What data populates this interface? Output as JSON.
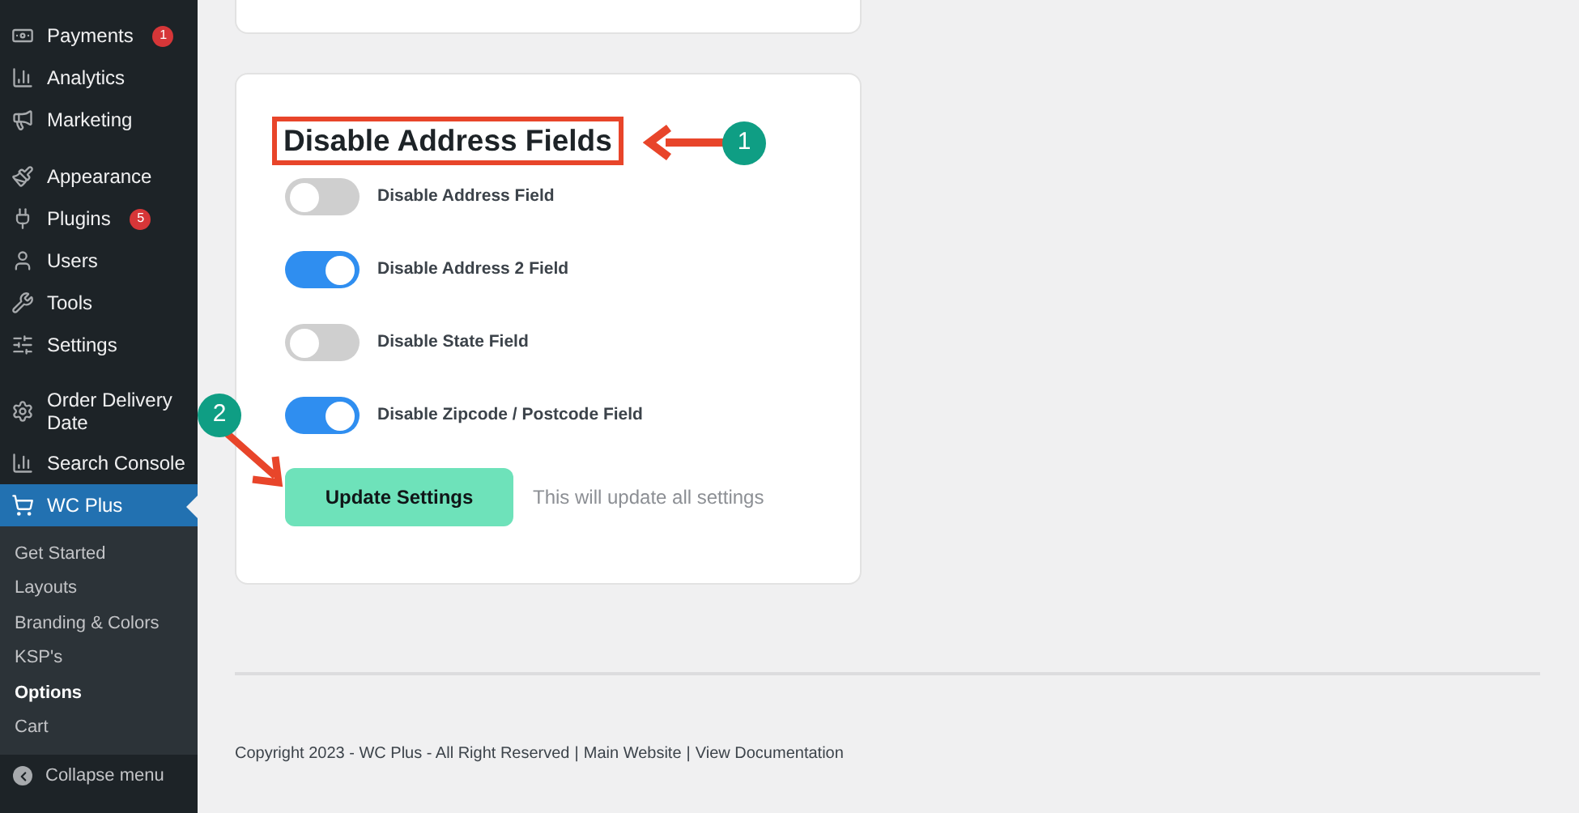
{
  "sidebar": {
    "groups": [
      [
        {
          "label": "Payments",
          "badge": "1",
          "selected": false
        },
        {
          "label": "Analytics",
          "selected": false
        },
        {
          "label": "Marketing",
          "selected": false
        }
      ],
      [
        {
          "label": "Appearance",
          "selected": false
        },
        {
          "label": "Plugins",
          "badge": "5",
          "selected": false
        },
        {
          "label": "Users",
          "selected": false
        },
        {
          "label": "Tools",
          "selected": false
        },
        {
          "label": "Settings",
          "selected": false
        }
      ],
      [
        {
          "label": "Order Delivery Date",
          "selected": false
        },
        {
          "label": "Search Console",
          "selected": false
        },
        {
          "label": "WC Plus",
          "selected": true
        }
      ]
    ],
    "submenu": [
      {
        "label": "Get Started",
        "selected": false
      },
      {
        "label": "Layouts",
        "selected": false
      },
      {
        "label": "Branding & Colors",
        "selected": false
      },
      {
        "label": "KSP's",
        "selected": false
      },
      {
        "label": "Options",
        "selected": true
      },
      {
        "label": "Cart",
        "selected": false
      }
    ],
    "collapse": "Collapse menu"
  },
  "card": {
    "title": "Disable Address Fields",
    "toggles": [
      {
        "label": "Disable Address Field",
        "on": false
      },
      {
        "label": "Disable Address 2 Field",
        "on": true
      },
      {
        "label": "Disable State Field",
        "on": false
      },
      {
        "label": "Disable Zipcode / Postcode Field",
        "on": true
      }
    ],
    "button": "Update Settings",
    "hint": "This will update all settings"
  },
  "annotations": [
    "1",
    "2"
  ],
  "footer": {
    "copyright": "Copyright 2023 - WC Plus - All Right Reserved",
    "separator": "|",
    "links": [
      "Main Website",
      "View Documentation"
    ]
  }
}
